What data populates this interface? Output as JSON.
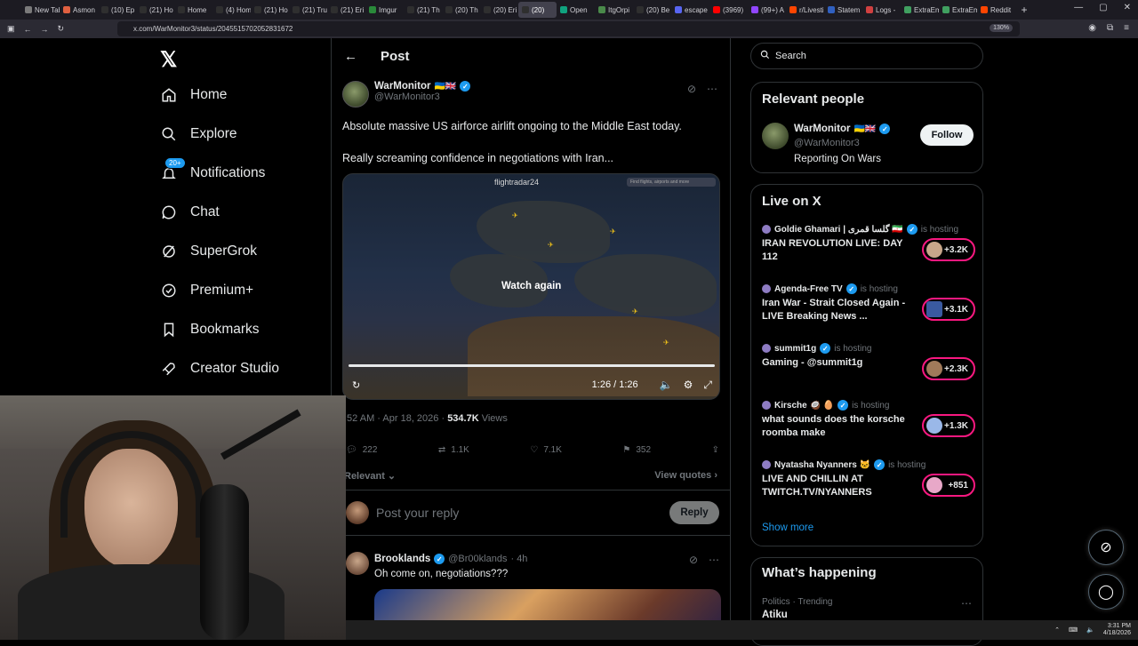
{
  "browser": {
    "tabs": [
      "New Tab",
      "Asmon",
      "(10) Ep",
      "(21) Ho",
      "Home",
      "(4) Hom",
      "(21) Ho",
      "(21) Tru",
      "(21) Eri",
      "Imgur",
      "(21) Th",
      "(20) Th",
      "(20) Eri",
      "(20)",
      "Open",
      "ItgOrpi",
      "(20) Be",
      "escape",
      "(3969)",
      "(99+) A",
      "r/Livesti",
      "Statem",
      "Logs -",
      "ExtraEm",
      "ExtraEm",
      "Reddit"
    ],
    "active_tab_index": 13,
    "url": "x.com/WarMonitor3/status/2045515702052831672",
    "zoom": "130%"
  },
  "nav": {
    "home": "Home",
    "explore": "Explore",
    "notifications": "Notifications",
    "notifications_badge": "20+",
    "chat": "Chat",
    "supergrok": "SuperGrok",
    "premium": "Premium+",
    "bookmarks": "Bookmarks",
    "creator_studio": "Creator Studio"
  },
  "post": {
    "header": "Post",
    "author_name": "WarMonitor",
    "author_flags": "🇺🇦🇬🇧",
    "author_handle": "@WarMonitor3",
    "text_line1": "Absolute massive US airforce airlift ongoing to the Middle East today.",
    "text_line2": "Really screaming confidence in negotiations with Iran...",
    "video": {
      "brand": "flightradar24",
      "search_placeholder": "Find flights, airports and more",
      "overlay": "Watch again",
      "time": "1:26 / 1:26",
      "progress": 1.0
    },
    "timestamp": ":52 AM · Apr 18, 2026 · ",
    "views_count": "534.7K",
    "views_label": " Views",
    "replies": "222",
    "reposts": "1.1K",
    "likes": "7.1K",
    "bookmarks": "352",
    "relevant": "Relevant",
    "view_quotes": "View quotes"
  },
  "reply": {
    "placeholder": "Post your reply",
    "button": "Reply"
  },
  "comment": {
    "name": "Brooklands",
    "handle": "@Br00klands",
    "time": "· 4h",
    "text": "Oh come on, negotiations???"
  },
  "sidebar": {
    "search_placeholder": "Search",
    "relevant_title": "Relevant people",
    "person": {
      "name": "WarMonitor",
      "flags": "🇺🇦🇬🇧",
      "handle": "@WarMonitor3",
      "bio": "Reporting On Wars",
      "follow": "Follow"
    },
    "live_title": "Live on X",
    "live": [
      {
        "host": "Goldie Ghamari | گلسا قمری 🇮🇷",
        "status": "is hosting",
        "title": "IRAN REVOLUTION LIVE: DAY 112",
        "count": "+3.2K"
      },
      {
        "host": "Agenda-Free TV",
        "status": "is hosting",
        "title": "Iran War - Strait Closed Again - LIVE Breaking News ...",
        "count": "+3.1K"
      },
      {
        "host": "summit1g",
        "status": "is hosting",
        "title": "Gaming - @summit1g",
        "count": "+2.3K"
      },
      {
        "host": "Kirsche 🥥 🥚",
        "status": "is hosting",
        "title": "what sounds does the korsche roomba make",
        "count": "+1.3K"
      },
      {
        "host": "Nyatasha Nyanners 🐱",
        "status": "is hosting",
        "title": "LIVE AND CHILLIN AT TWITCH.TV/NYANNERS",
        "count": "+851"
      }
    ],
    "show_more": "Show more",
    "happening_title": "What’s happening",
    "trend_category": "Politics · Trending",
    "trend_term": "Atiku"
  },
  "taskbar": {
    "time": "3:31 PM",
    "date": "4/18/2026"
  },
  "colors": {
    "accent": "#1d9bf0",
    "live_ring": "#f91880",
    "background": "#000000",
    "border": "#2f3336"
  }
}
